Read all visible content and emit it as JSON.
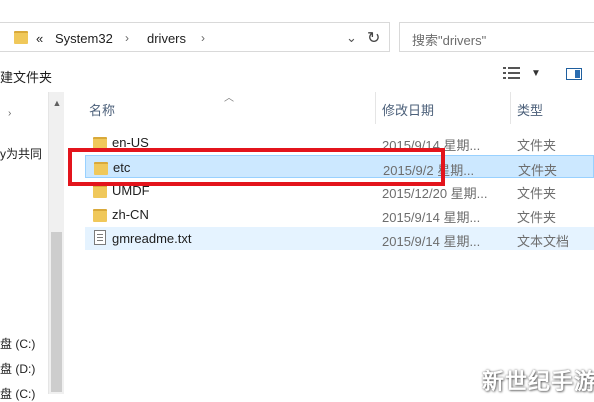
{
  "address_bar": {
    "overflow_chevron": "«",
    "breadcrumb": [
      "System32",
      "drivers"
    ],
    "separator": "›",
    "dropdown_glyph": "⌄",
    "refresh_glyph": "↻"
  },
  "search": {
    "placeholder": "搜索\"drivers\""
  },
  "toolbar": {
    "new_folder": "建文件夹",
    "view_dropdown_glyph": "▼"
  },
  "nav_pane": {
    "share_item": "y为共同",
    "drives": [
      "盘 (C:)",
      "盘 (D:)",
      "盘 (C:)"
    ]
  },
  "columns": {
    "name": "名称",
    "modified": "修改日期",
    "type": "类型"
  },
  "files": [
    {
      "name": "en-US",
      "modified": "2015/9/14 星期...",
      "type": "文件夹",
      "icon": "folder-icon"
    },
    {
      "name": "etc",
      "modified": "2015/9/2 星期...",
      "type": "文件夹",
      "icon": "folder-icon",
      "selected": true
    },
    {
      "name": "UMDF",
      "modified": "2015/12/20 星期...",
      "type": "文件夹",
      "icon": "folder-icon"
    },
    {
      "name": "zh-CN",
      "modified": "2015/9/14 星期...",
      "type": "文件夹",
      "icon": "folder-icon"
    },
    {
      "name": "gmreadme.txt",
      "modified": "2015/9/14 星期...",
      "type": "文本文档",
      "icon": "text-file-icon",
      "hover": true
    }
  ],
  "colors": {
    "selection": "#cce8ff",
    "highlight_box": "#e3141c",
    "header_text": "#4c607a"
  },
  "watermark": "新世纪手游"
}
